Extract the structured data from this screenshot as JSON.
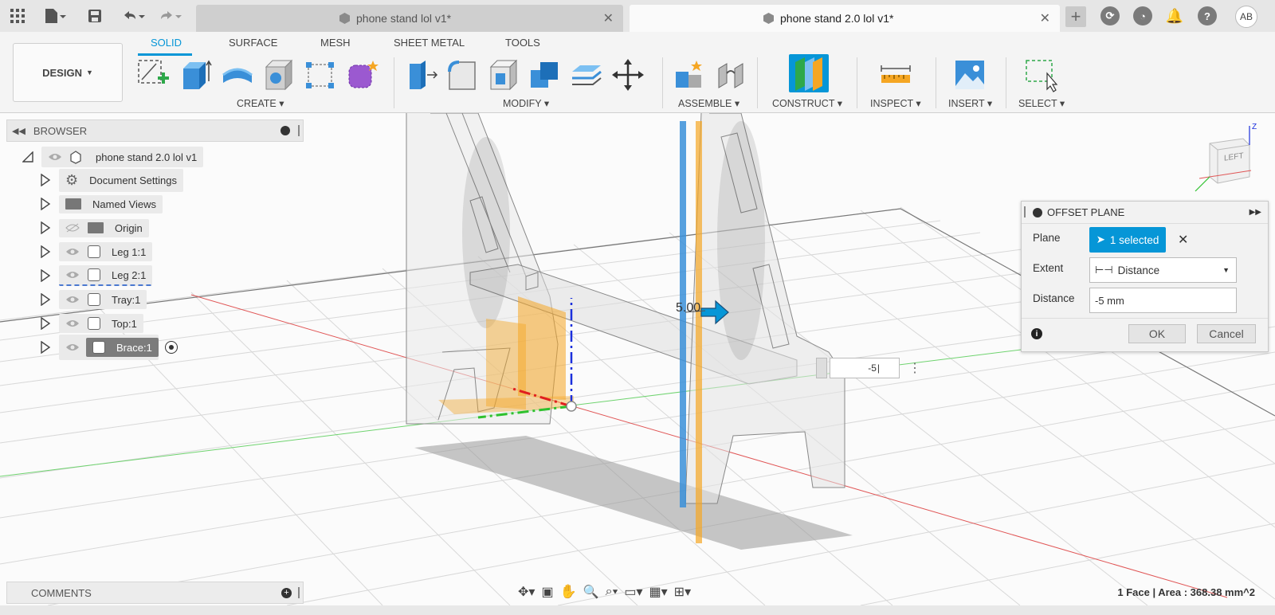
{
  "window": {
    "tabs": [
      {
        "label": "phone stand lol v1*",
        "active": false
      },
      {
        "label": "phone stand 2.0 lol v1*",
        "active": true
      }
    ],
    "user_initials": "AB"
  },
  "toolbar": {
    "design_label": "DESIGN",
    "workspace_tabs": [
      "SOLID",
      "SURFACE",
      "MESH",
      "SHEET METAL",
      "TOOLS"
    ],
    "groups": [
      "CREATE",
      "MODIFY",
      "ASSEMBLE",
      "CONSTRUCT",
      "INSPECT",
      "INSERT",
      "SELECT"
    ]
  },
  "browser": {
    "title": "BROWSER",
    "root": "phone stand 2.0 lol v1",
    "items": [
      {
        "label": "Document Settings",
        "icon": "gear-icon"
      },
      {
        "label": "Named Views",
        "icon": "folder-icon"
      },
      {
        "label": "Origin",
        "icon": "folder-icon",
        "hidden": true
      },
      {
        "label": "Leg 1:1",
        "icon": "component-icon"
      },
      {
        "label": "Leg 2:1",
        "icon": "component-icon"
      },
      {
        "label": "Tray:1",
        "icon": "component-icon"
      },
      {
        "label": "Top:1",
        "icon": "component-icon"
      },
      {
        "label": "Brace:1",
        "icon": "component-icon",
        "selected": true
      }
    ]
  },
  "comments": {
    "title": "COMMENTS"
  },
  "offset_plane": {
    "title": "OFFSET PLANE",
    "plane_label": "Plane",
    "plane_value": "1 selected",
    "extent_label": "Extent",
    "extent_value": "Distance",
    "distance_label": "Distance",
    "distance_value": "-5 mm",
    "ok_label": "OK",
    "cancel_label": "Cancel"
  },
  "viewport": {
    "dimension_label": "5.00",
    "input_value": "-5",
    "viewcube_label": "LEFT",
    "axis_z": "Z"
  },
  "status": {
    "text": "1 Face | Area : 368.38 mm^2"
  },
  "colors": {
    "accent": "#0696d7",
    "selection": "#f5a623"
  }
}
